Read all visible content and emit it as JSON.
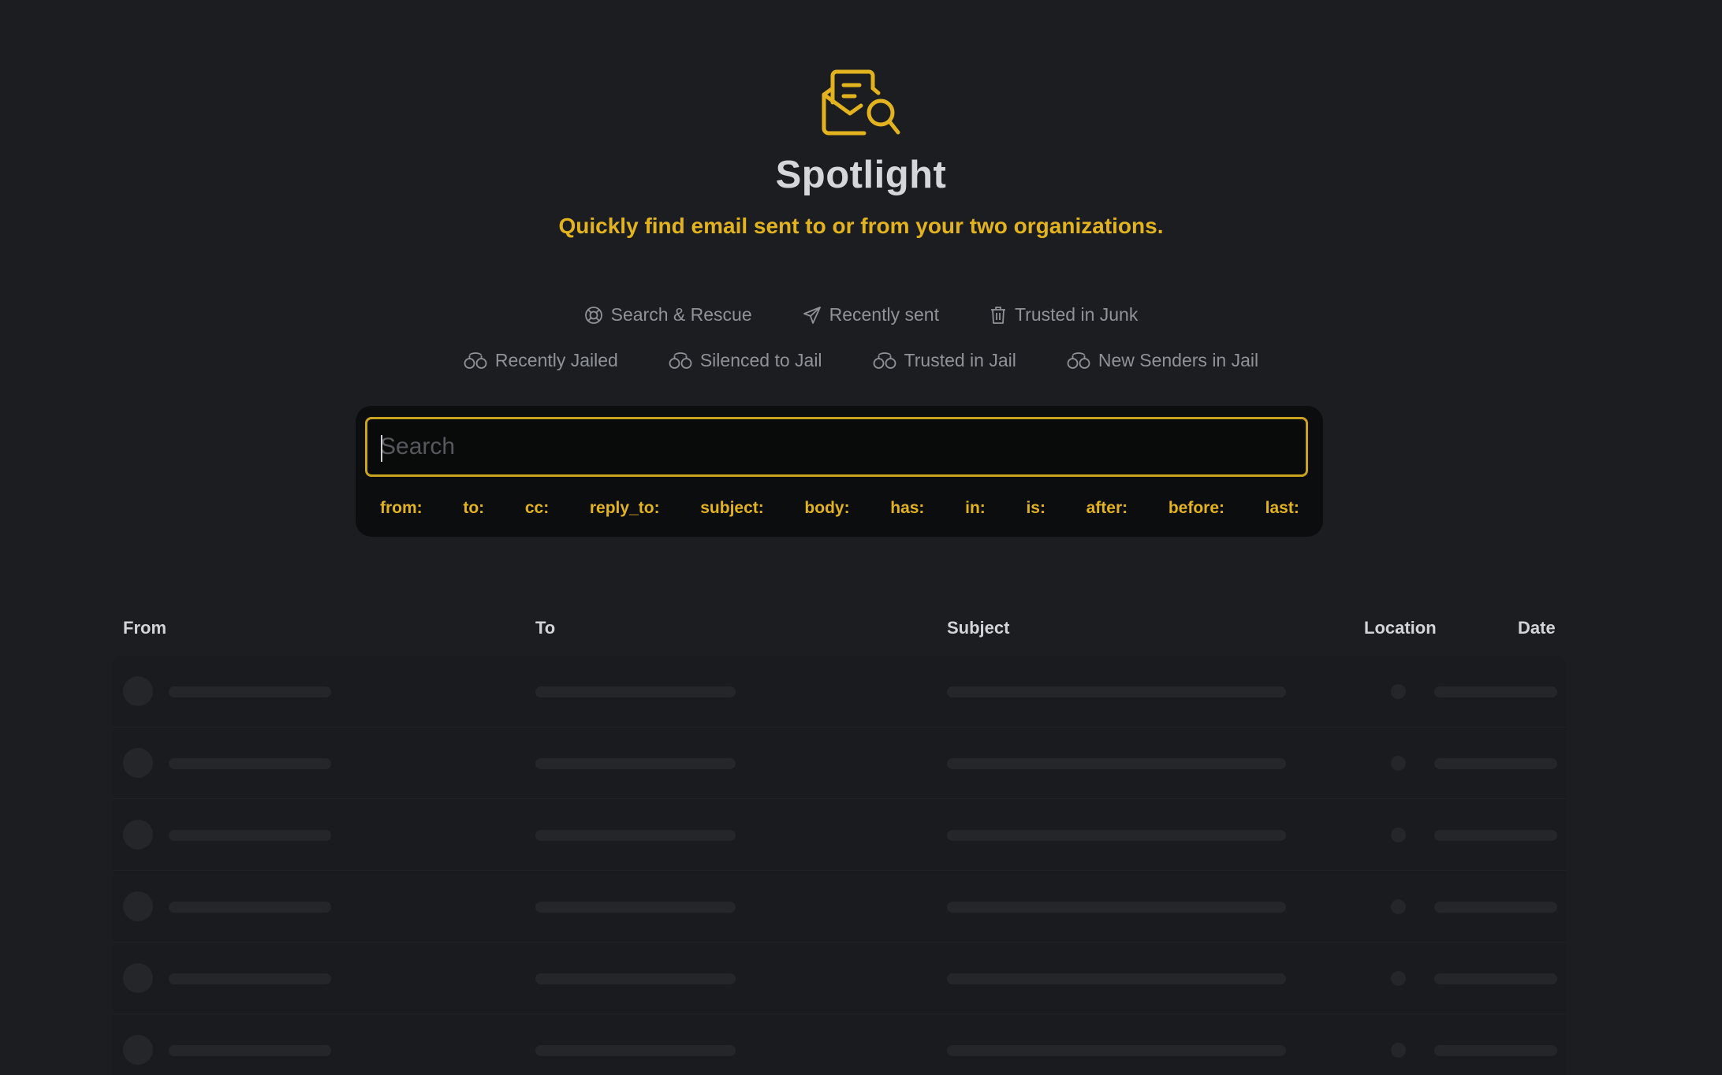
{
  "header": {
    "icon": "mail-search-icon",
    "title": "Spotlight",
    "subtitle": "Quickly find email sent to or from your two organizations."
  },
  "shortcuts": {
    "row1": [
      {
        "label": "Search & Rescue",
        "icon": "lifebuoy-icon"
      },
      {
        "label": "Recently sent",
        "icon": "paper-plane-icon"
      },
      {
        "label": "Trusted in Junk",
        "icon": "trash-icon"
      }
    ],
    "row2": [
      {
        "label": "Recently Jailed",
        "icon": "handcuffs-icon"
      },
      {
        "label": "Silenced to Jail",
        "icon": "handcuffs-icon"
      },
      {
        "label": "Trusted in Jail",
        "icon": "handcuffs-icon"
      },
      {
        "label": "New Senders in Jail",
        "icon": "handcuffs-icon"
      }
    ]
  },
  "search": {
    "placeholder": "Search",
    "value": "",
    "operators": [
      "from:",
      "to:",
      "cc:",
      "reply_to:",
      "subject:",
      "body:",
      "has:",
      "in:",
      "is:",
      "after:",
      "before:",
      "last:"
    ]
  },
  "table": {
    "columns": [
      "From",
      "To",
      "Subject",
      "Location",
      "Date"
    ],
    "loading_rows": 6
  },
  "colors": {
    "accent": "#e3b31f",
    "background": "#1b1d20",
    "panel": "#0c0d0e"
  }
}
